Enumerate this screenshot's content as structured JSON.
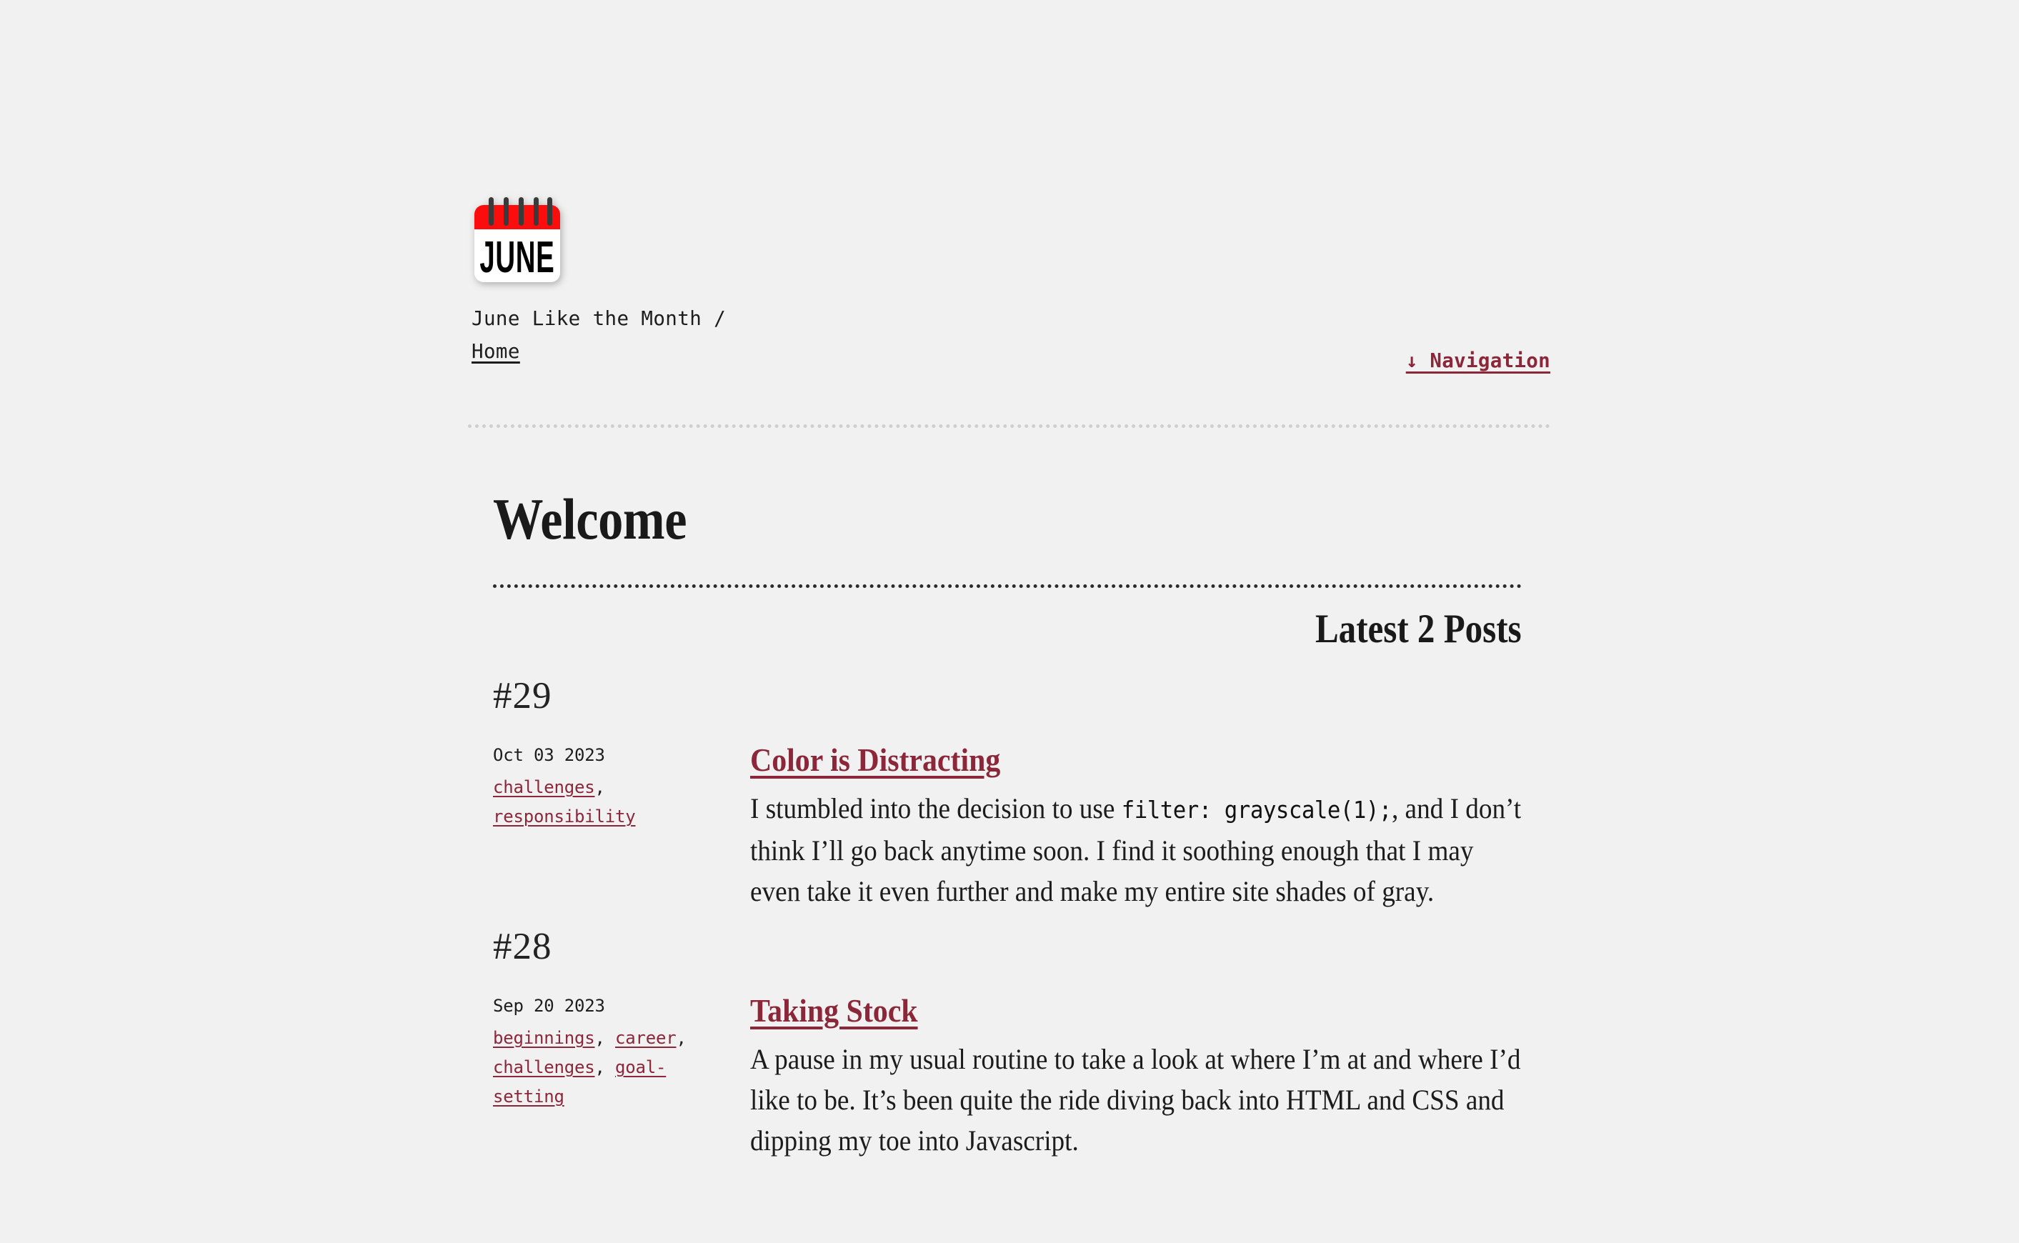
{
  "site": {
    "background_color": "#f1f1f1",
    "accent_color": "#8c2739",
    "text_color": "#1c1c1c",
    "logo": {
      "icon": "calendar-icon",
      "label": "JUNE",
      "band_color": "#fb0d0d",
      "face_color": "#ffffff",
      "ring_color": "#3a3a3a",
      "rings": 5
    }
  },
  "header": {
    "brand_title": "June Like the Month /",
    "breadcrumb_home": "Home",
    "nav_toggle": "↓ Navigation",
    "nav_arrow_glyph": "↓",
    "nav_label": "Navigation"
  },
  "main": {
    "page_title": "Welcome",
    "latest_label": "Latest 2 Posts"
  },
  "posts": [
    {
      "number": "#29",
      "date": "Oct 03 2023",
      "tags": [
        "challenges",
        "responsibility"
      ],
      "title": "Color is Distracting",
      "excerpt_before": "I stumbled into the decision to use ",
      "excerpt_code": "filter: grayscale(1);",
      "excerpt_after": ", and I don’t think I’ll go back anytime soon. I find it soothing enough that I may even take it even further and make my entire site shades of gray."
    },
    {
      "number": "#28",
      "date": "Sep 20 2023",
      "tags": [
        "beginnings",
        "career",
        "challenges",
        "goal-setting"
      ],
      "title": "Taking Stock",
      "excerpt_before": "A pause in my usual routine to take a look at where I’m at and where I’d like to be. It’s been quite the ride diving back into HTML and CSS and dipping my toe into Javascript.",
      "excerpt_code": "",
      "excerpt_after": ""
    }
  ]
}
